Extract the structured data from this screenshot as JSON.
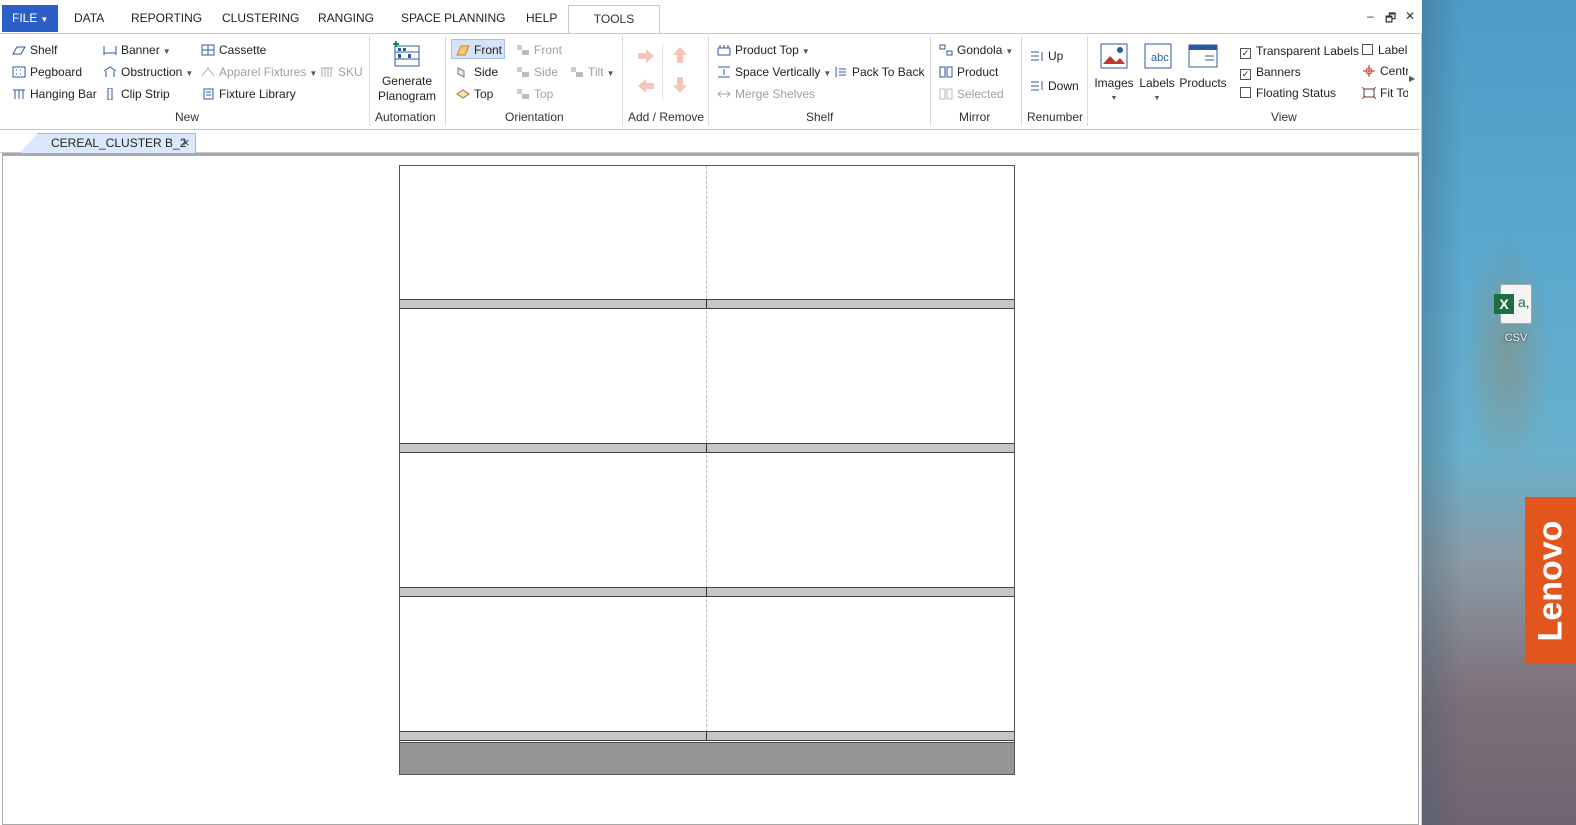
{
  "menubar": {
    "file_label": "FILE",
    "tabs": [
      "DATA",
      "REPORTING",
      "CLUSTERING",
      "RANGING",
      "SPACE PLANNING",
      "HELP",
      "TOOLS"
    ],
    "active_tab": "TOOLS",
    "window_controls": [
      "–",
      "🗗",
      "✕"
    ]
  },
  "ribbon": {
    "new": {
      "label": "New",
      "items": [
        "Shelf",
        "Pegboard",
        "Hanging Bar",
        "Banner",
        "Obstruction",
        "Clip Strip",
        "Cassette",
        "Apparel Fixtures",
        "Fixture Library",
        "SKU"
      ]
    },
    "automation": {
      "label": "Automation",
      "generate_l1": "Generate",
      "generate_l2": "Planogram"
    },
    "orientation": {
      "label": "Orientation",
      "items": [
        "Front",
        "Side",
        "Top",
        "Front",
        "Side",
        "Top",
        "Tilt"
      ]
    },
    "add_remove": {
      "label": "Add / Remove"
    },
    "shelf": {
      "label": "Shelf",
      "items": [
        "Product Top",
        "Space Vertically",
        "Merge Shelves",
        "Pack To Back"
      ]
    },
    "mirror": {
      "label": "Mirror",
      "items": [
        "Gondola",
        "Product",
        "Selected"
      ]
    },
    "renumber": {
      "label": "Renumber",
      "items": [
        "Up",
        "Down"
      ]
    },
    "view": {
      "label": "View",
      "big": [
        "Images",
        "Labels",
        "Products"
      ],
      "checks": [
        {
          "label": "Transparent Labels",
          "checked": true
        },
        {
          "label": "Banners",
          "checked": true
        },
        {
          "label": "Floating Status",
          "checked": false
        },
        {
          "label": "Label",
          "checked": false
        }
      ],
      "cent": "Centr",
      "fit": "Fit To"
    }
  },
  "document": {
    "tab_title": "CEREAL_CLUSTER B_2",
    "close": "×"
  },
  "desktop": {
    "csv_label": "CSV",
    "xbadge": "X",
    "aglyph": "a,",
    "brand": "Lenovo"
  },
  "colors": {
    "file_blue": "#2b5fc7",
    "selected": "#d5e2f7",
    "lenovo": "#e2561e",
    "shelf": "#c6c6c6",
    "base": "#969696"
  }
}
